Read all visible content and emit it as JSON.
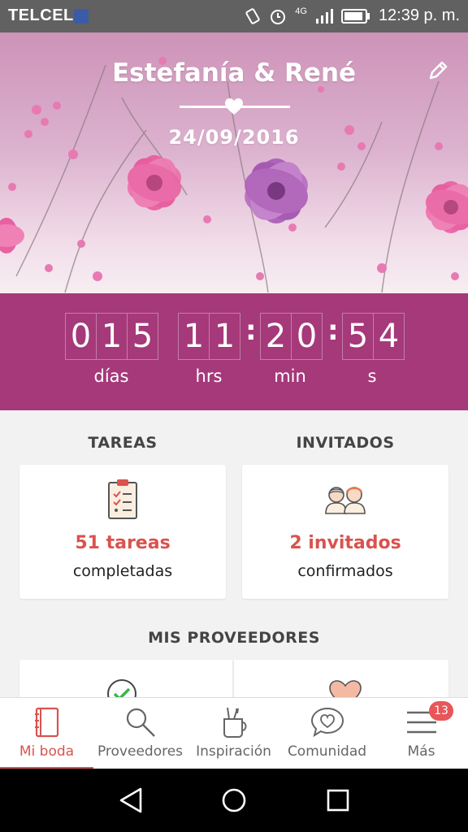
{
  "status_bar": {
    "carrier": "TELCEL",
    "network": "4G",
    "time": "12:39 p. m."
  },
  "header": {
    "couple_names": "Estefanía & René",
    "wedding_date": "24/09/2016"
  },
  "countdown": {
    "days": [
      "0",
      "1",
      "5"
    ],
    "hours": [
      "1",
      "1"
    ],
    "minutes": [
      "2",
      "0"
    ],
    "seconds": [
      "5",
      "4"
    ],
    "labels": {
      "days": "días",
      "hours": "hrs",
      "minutes": "min",
      "seconds": "s"
    }
  },
  "tasks": {
    "title": "TAREAS",
    "count": "51 tareas",
    "sub": "completadas"
  },
  "guests": {
    "title": "INVITADOS",
    "count": "2 invitados",
    "sub": "confirmados"
  },
  "providers": {
    "title": "MIS PROVEEDORES"
  },
  "bottom_nav": {
    "items": [
      {
        "label": "Mi boda",
        "icon": "notebook-icon",
        "active": true
      },
      {
        "label": "Proveedores",
        "icon": "search-icon",
        "active": false
      },
      {
        "label": "Inspiración",
        "icon": "brush-cup-icon",
        "active": false
      },
      {
        "label": "Comunidad",
        "icon": "chat-heart-icon",
        "active": false
      },
      {
        "label": "Más",
        "icon": "menu-icon",
        "active": false
      }
    ],
    "more_badge": "13"
  },
  "colors": {
    "accent": "#d9534f",
    "countdown_bg": "#a5397a"
  }
}
